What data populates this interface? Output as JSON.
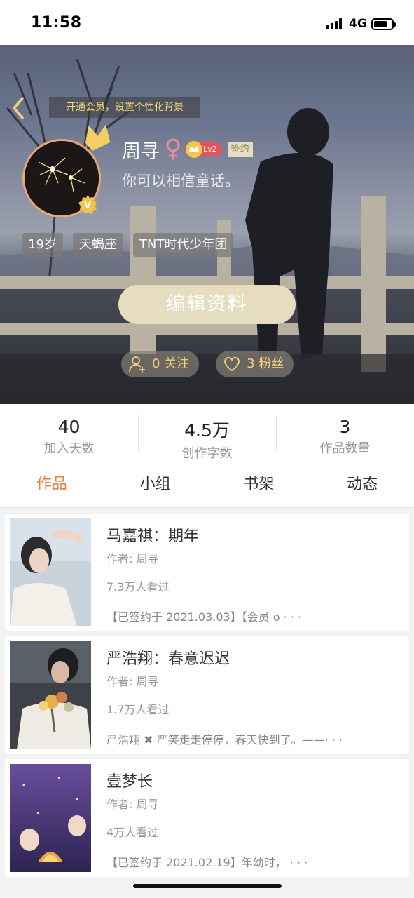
{
  "status_bar": {
    "time": "11:58",
    "network": "4G"
  },
  "profile": {
    "vip_banner": "开通会员，设置个性化背景",
    "name": "周寻",
    "level": "Lv2",
    "signed": "签约",
    "bio": "你可以相信童话。",
    "tags": [
      "19岁",
      "天蝎座",
      "TNT时代少年团"
    ],
    "edit_button": "编辑资料",
    "following": "0 关注",
    "followers": "3 粉丝"
  },
  "stats": [
    {
      "value": "40",
      "label": "加入天数"
    },
    {
      "value": "4.5万",
      "label": "创作字数"
    },
    {
      "value": "3",
      "label": "作品数量"
    }
  ],
  "tabs": [
    "作品",
    "小组",
    "书架",
    "动态"
  ],
  "works": [
    {
      "title": "马嘉祺：期年",
      "author": "作者: 周寻",
      "views": "7.3万人看过",
      "desc": "【已签约于 2021.03.03】【会员 o · · ·"
    },
    {
      "title": "严浩翔：春意迟迟",
      "author": "作者: 周寻",
      "views": "1.7万人看过",
      "desc": "严浩翔 ✖ 严笑走走停停，春天快到了。——· · ·"
    },
    {
      "title": "壹梦长",
      "author": "作者: 周寻",
      "views": "4万人看过",
      "desc": "【已签约于 2021.02.19】年幼时，  · · ·"
    }
  ],
  "colors": {
    "accent": "#e8844a",
    "gold": "#f1d27b",
    "beige": "#e6dcc0"
  }
}
